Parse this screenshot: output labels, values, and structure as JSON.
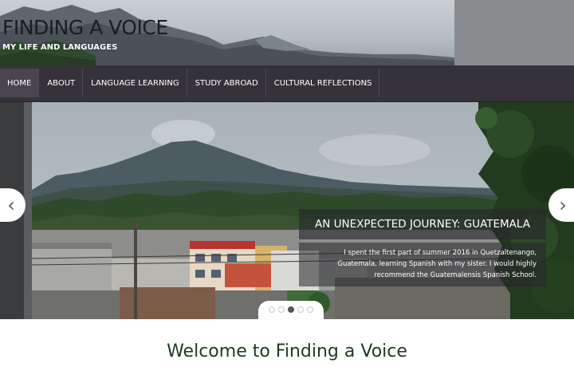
{
  "header": {
    "title": "FINDING A VOICE",
    "tagline": "MY LIFE AND LANGUAGES"
  },
  "nav": {
    "items": [
      {
        "label": "HOME",
        "active": true
      },
      {
        "label": "ABOUT",
        "active": false
      },
      {
        "label": "LANGUAGE LEARNING",
        "active": false
      },
      {
        "label": "STUDY ABROAD",
        "active": false
      },
      {
        "label": "CULTURAL REFLECTIONS",
        "active": false
      }
    ]
  },
  "slider": {
    "prev_icon": "chevron-left-icon",
    "next_icon": "chevron-right-icon",
    "prev_glyph": "‹",
    "next_glyph": "›",
    "caption_title": "AN UNEXPECTED JOURNEY: GUATEMALA",
    "caption_text": "I spent the first part of summer 2016 in Quetzaltenango, Guatemala, learning Spanish with my sister. I would highly recommend the Guatemalensis Spanish School.",
    "slide_count": 5,
    "active_slide": 3
  },
  "content": {
    "heading": "Welcome to Finding a Voice"
  },
  "colors": {
    "nav_background": "#363239",
    "heading_green": "#1e3b1e",
    "caption_overlay": "#28262c"
  }
}
